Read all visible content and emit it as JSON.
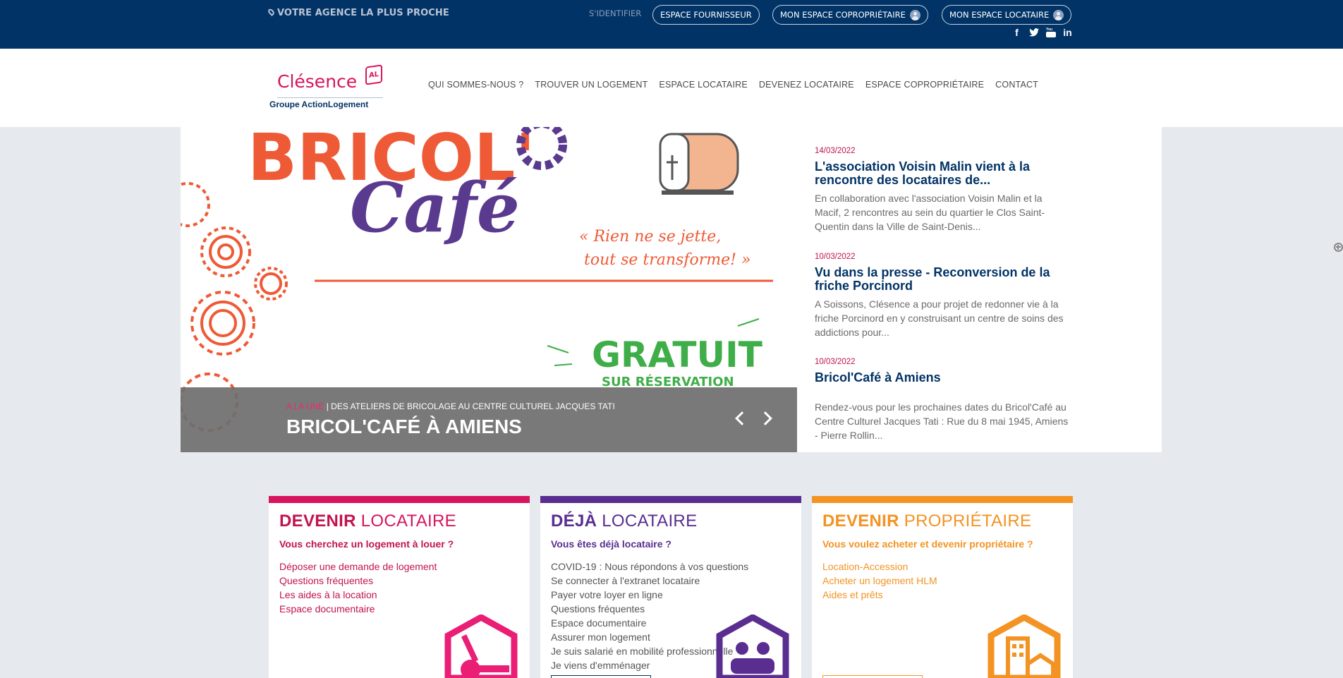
{
  "topbar": {
    "agency_label": "VOTRE AGENCE LA PLUS PROCHE",
    "identify_label": "S'IDENTIFIER",
    "buttons": [
      {
        "label": "ESPACE FOURNISSEUR"
      },
      {
        "label": "MON ESPACE COPROPRIÉTAIRE"
      },
      {
        "label": "MON ESPACE LOCATAIRE"
      }
    ],
    "social": [
      "facebook-icon",
      "twitter-icon",
      "youtube-icon",
      "linkedin-icon"
    ]
  },
  "logo": {
    "brand": "Clésence",
    "badge": "AL",
    "group": "Groupe ActionLogement"
  },
  "nav": {
    "items": [
      {
        "label": "QUI SOMMES-NOUS ?"
      },
      {
        "label": "TROUVER UN LOGEMENT"
      },
      {
        "label": "ESPACE LOCATAIRE"
      },
      {
        "label": "DEVENEZ LOCATAIRE"
      },
      {
        "label": "ESPACE COPROPRIÉTAIRE"
      },
      {
        "label": "CONTACT"
      }
    ]
  },
  "slide": {
    "poster_title_1": "BRICOL'",
    "poster_title_2": "Café",
    "poster_quote_1": "« Rien ne se jette,",
    "poster_quote_2": "tout se transforme! »",
    "poster_free": "GRATUIT",
    "poster_reservation": "SUR RÉSERVATION",
    "kicker_tag": "A LA UNE",
    "kicker_text": " | DES ATELIERS DE BRICOLAGE AU CENTRE CULTUREL JACQUES TATI",
    "title": "BRICOL'CAFÉ À AMIENS"
  },
  "news": [
    {
      "date": "14/03/2022",
      "title": "L'association Voisin Malin vient à la rencontre des locataires de...",
      "text": "En collaboration avec l'association Voisin Malin et la Macif, 2 rencontres au sein du quartier le Clos Saint-Quentin dans la Ville de Saint-Denis..."
    },
    {
      "date": "10/03/2022",
      "title": "Vu dans la presse - Reconversion de la friche Porcinord",
      "text": "A Soissons, Clésence a pour projet de redonner vie à la friche Porcinord en y construisant un centre de soins des addictions pour..."
    },
    {
      "date": "10/03/2022",
      "title": "Bricol'Café à Amiens",
      "text": "Rendez-vous pour les prochaines dates du Bricol'Café au Centre Culturel Jacques Tati : Rue du 8 mai 1945, Amiens - Pierre Rollin..."
    }
  ],
  "cards": [
    {
      "title_bold": "DEVENIR",
      "title_light": "LOCATAIRE",
      "question": "Vous cherchez un logement à louer ?",
      "links": [
        "Déposer une demande de logement",
        "Questions fréquentes",
        "Les aides à la location",
        "Espace documentaire"
      ],
      "color": "#d6155d"
    },
    {
      "title_bold": "DÉJÀ",
      "title_light": "LOCATAIRE",
      "question": "Vous êtes déjà locataire ?",
      "links": [
        "COVID-19 : Nous répondons à vos questions",
        "Se connecter à l'extranet locataire",
        "Payer votre loyer en ligne",
        "Questions fréquentes",
        "Espace documentaire",
        "Assurer mon logement",
        "Je suis salarié en mobilité professionnelle",
        "Je viens d'emménager"
      ],
      "color": "#5a2d91"
    },
    {
      "title_bold": "DEVENIR",
      "title_light": "PROPRIÉTAIRE",
      "question": "Vous voulez acheter et devenir propriétaire ?",
      "links": [
        "Location-Accession",
        "Acheter un logement HLM",
        "Aides et prêts"
      ],
      "color": "#f39323"
    }
  ],
  "colors": {
    "navy": "#013366",
    "pink": "#d6155d",
    "purple": "#5a2d91",
    "orange": "#f39323"
  }
}
